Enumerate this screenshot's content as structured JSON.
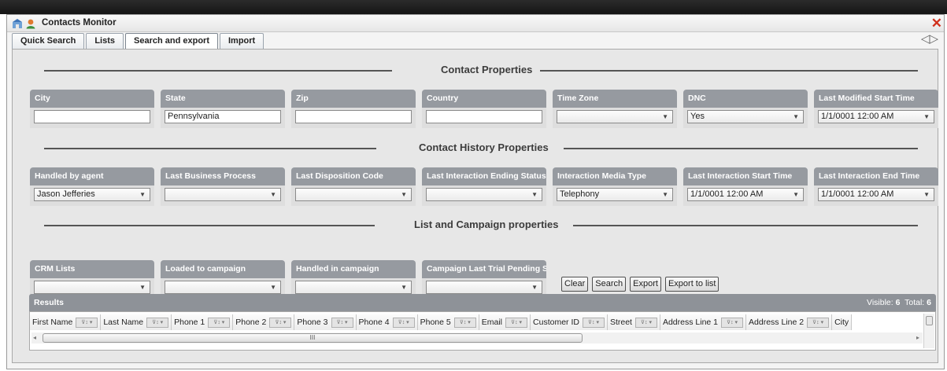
{
  "window": {
    "title": "Contacts Monitor"
  },
  "tabs": [
    "Quick Search",
    "Lists",
    "Search and export",
    "Import"
  ],
  "active_tab": "Search and export",
  "sections": {
    "contact": "Contact Properties",
    "history": "Contact History Properties",
    "campaign": "List and Campaign properties"
  },
  "contact_fields": [
    {
      "label": "City",
      "value": "",
      "kind": "text"
    },
    {
      "label": "State",
      "value": "Pennsylvania",
      "kind": "text"
    },
    {
      "label": "Zip",
      "value": "",
      "kind": "text"
    },
    {
      "label": "Country",
      "value": "",
      "kind": "text"
    },
    {
      "label": "Time Zone",
      "value": "",
      "kind": "select"
    },
    {
      "label": "DNC",
      "value": "Yes",
      "kind": "select"
    },
    {
      "label": "Last Modified Start Time",
      "value": "1/1/0001 12:00 AM",
      "kind": "select"
    }
  ],
  "history_fields": [
    {
      "label": "Handled by agent",
      "value": "Jason Jefferies",
      "kind": "select"
    },
    {
      "label": "Last Business Process",
      "value": "",
      "kind": "select"
    },
    {
      "label": "Last Disposition Code",
      "value": "",
      "kind": "select"
    },
    {
      "label": "Last Interaction Ending Status",
      "value": "",
      "kind": "select"
    },
    {
      "label": "Interaction Media Type",
      "value": "Telephony",
      "kind": "select"
    },
    {
      "label": "Last Interaction Start Time",
      "value": "1/1/0001 12:00 AM",
      "kind": "select"
    },
    {
      "label": "Last Interaction End Time",
      "value": "1/1/0001 12:00 AM",
      "kind": "select"
    }
  ],
  "campaign_fields": [
    {
      "label": "CRM Lists",
      "value": "",
      "kind": "select"
    },
    {
      "label": "Loaded to campaign",
      "value": "",
      "kind": "select"
    },
    {
      "label": "Handled in campaign",
      "value": "",
      "kind": "select"
    },
    {
      "label": "Campaign Last Trial Pending Sta",
      "value": "",
      "kind": "select"
    }
  ],
  "buttons": [
    "Clear",
    "Search",
    "Export",
    "Export to list"
  ],
  "results": {
    "title": "Results",
    "visible_label": "Visible:",
    "visible_count": "6",
    "total_label": "Total:",
    "total_count": "6",
    "columns": [
      "First Name",
      "Last Name",
      "Phone 1",
      "Phone 2",
      "Phone 3",
      "Phone 4",
      "Phone 5",
      "Email",
      "Customer ID",
      "Street",
      "Address Line 1",
      "Address Line 2",
      "City"
    ],
    "scroll_grip": "III"
  }
}
